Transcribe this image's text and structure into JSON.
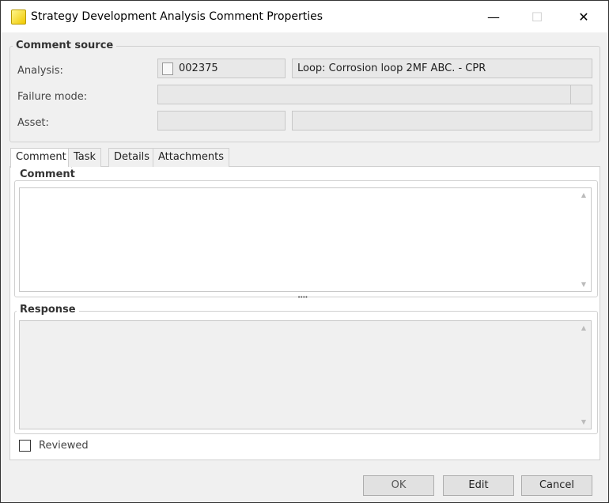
{
  "window": {
    "title": "Strategy Development Analysis Comment Properties",
    "minimize": "—",
    "maximize": "☐",
    "close": "✕"
  },
  "source": {
    "title": "Comment source",
    "analysis_label": "Analysis:",
    "analysis_id": "002375",
    "analysis_desc": "Loop: Corrosion loop 2MF ABC. - CPR",
    "failure_label": "Failure mode:",
    "failure_value": "",
    "asset_label": "Asset:",
    "asset_id": "",
    "asset_desc": ""
  },
  "tabs": [
    "Comment",
    "Task",
    "Details",
    "Attachments"
  ],
  "comment": {
    "title": "Comment",
    "value": ""
  },
  "splitter": "••••",
  "response": {
    "title": "Response",
    "value": ""
  },
  "reviewed": {
    "label": "Reviewed",
    "checked": false
  },
  "buttons": {
    "ok": "OK",
    "edit": "Edit",
    "cancel": "Cancel"
  }
}
